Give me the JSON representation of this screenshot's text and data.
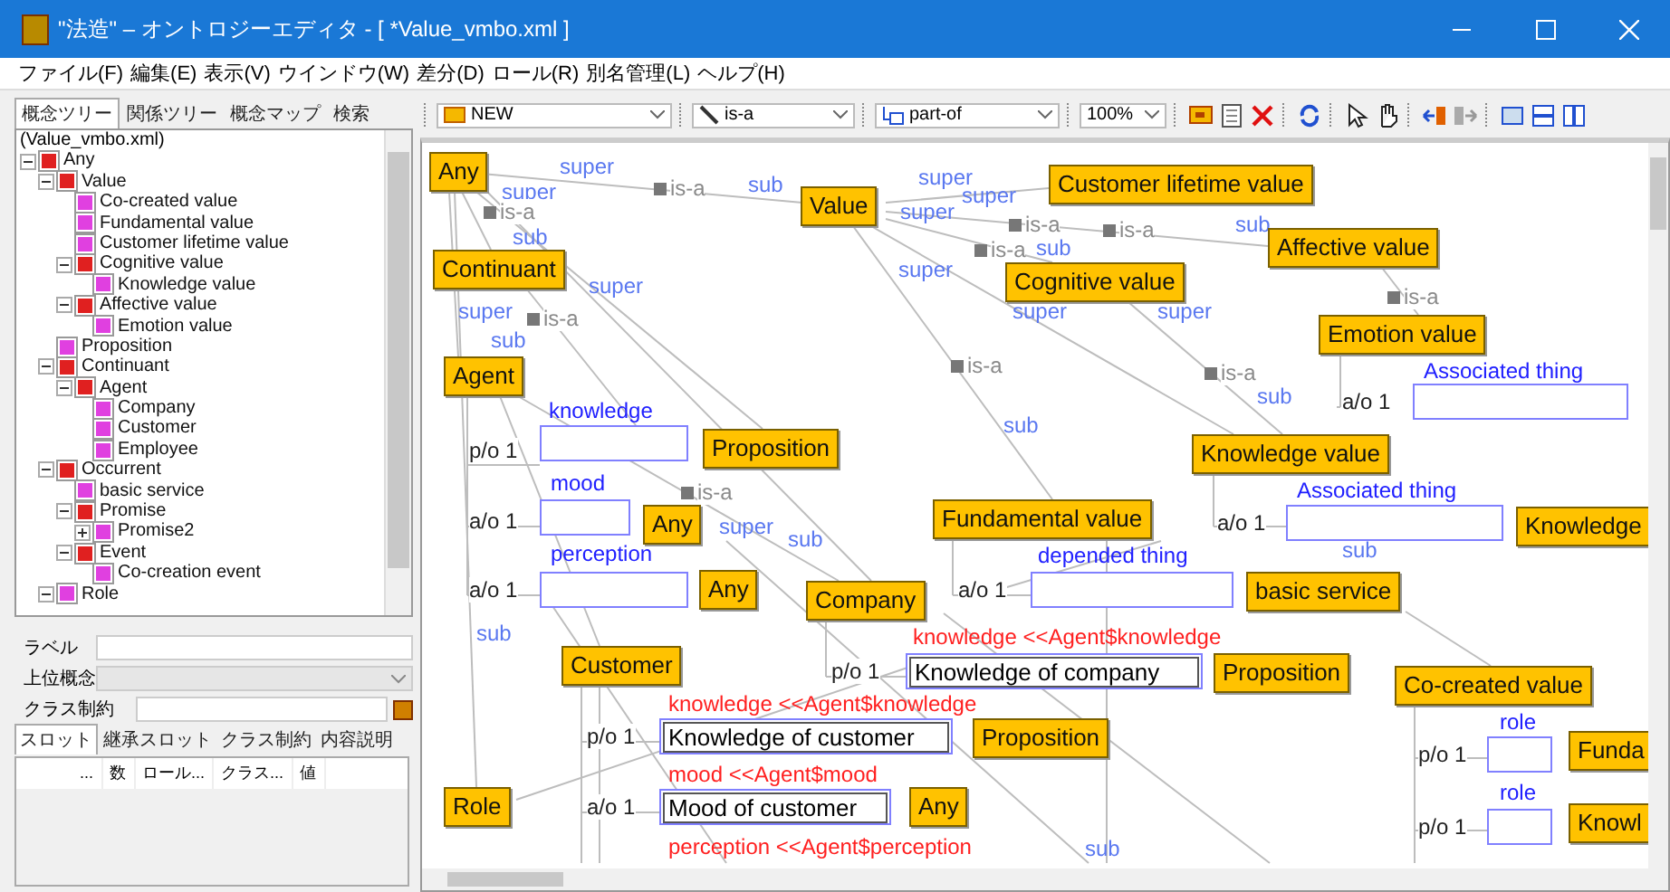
{
  "window": {
    "title": "\"法造\" – オントロジーエディタ - [ *Value_vmbo.xml ]"
  },
  "menu": [
    "ファイル(F)",
    "編集(E)",
    "表示(V)",
    "ウインドウ(W)",
    "差分(D)",
    "ロール(R)",
    "別名管理(L)",
    "ヘルプ(H)"
  ],
  "left_tabs": [
    {
      "label": "概念ツリー",
      "selected": true
    },
    {
      "label": "関係ツリー",
      "selected": false
    },
    {
      "label": "概念マップ",
      "selected": false
    },
    {
      "label": "検索",
      "selected": false
    }
  ],
  "tree": {
    "file": "(Value_vmbo.xml)",
    "items": [
      {
        "label": "Any",
        "color": "#e02020",
        "expanded": true,
        "children": [
          {
            "label": "Value",
            "color": "#e02020",
            "expanded": true,
            "children": [
              {
                "label": "Co-created value",
                "color": "#e040e0"
              },
              {
                "label": "Fundamental value",
                "color": "#e040e0"
              },
              {
                "label": "Customer lifetime value",
                "color": "#e040e0"
              },
              {
                "label": "Cognitive value",
                "color": "#e02020",
                "expanded": true,
                "children": [
                  {
                    "label": "Knowledge value",
                    "color": "#e040e0"
                  }
                ]
              },
              {
                "label": "Affective value",
                "color": "#e02020",
                "expanded": true,
                "children": [
                  {
                    "label": "Emotion value",
                    "color": "#e040e0"
                  }
                ]
              }
            ]
          },
          {
            "label": "Proposition",
            "color": "#e040e0"
          },
          {
            "label": "Continuant",
            "color": "#e02020",
            "expanded": true,
            "children": [
              {
                "label": "Agent",
                "color": "#e02020",
                "expanded": true,
                "children": [
                  {
                    "label": "Company",
                    "color": "#e040e0"
                  },
                  {
                    "label": "Customer",
                    "color": "#e040e0"
                  },
                  {
                    "label": "Employee",
                    "color": "#e040e0"
                  }
                ]
              }
            ]
          },
          {
            "label": "Occurrent",
            "color": "#e02020",
            "expanded": true,
            "children": [
              {
                "label": "basic service",
                "color": "#e040e0"
              },
              {
                "label": "Promise",
                "color": "#e02020",
                "expanded": true,
                "children": [
                  {
                    "label": "Promise2",
                    "color": "#e040e0",
                    "expanded": false
                  }
                ]
              },
              {
                "label": "Event",
                "color": "#e02020",
                "expanded": true,
                "children": [
                  {
                    "label": "Co-creation event",
                    "color": "#e040e0"
                  }
                ]
              }
            ]
          },
          {
            "label": "Role",
            "color": "#e040e0",
            "expanded": true
          }
        ]
      }
    ]
  },
  "form": {
    "label_field": "ラベル",
    "super_field": "上位概念",
    "class_constraint_field": "クラス制約"
  },
  "detail_tabs": [
    {
      "label": "スロット",
      "selected": true
    },
    {
      "label": "継承スロット",
      "selected": false
    },
    {
      "label": "クラス制約",
      "selected": false
    },
    {
      "label": "内容説明",
      "selected": false
    }
  ],
  "slot_table": {
    "columns": [
      "...",
      "数",
      "ロール...",
      "クラス...",
      "値"
    ]
  },
  "toolbar": {
    "node_type": "NEW",
    "link_type": "is-a",
    "part_type": "part-of",
    "zoom": "100%"
  },
  "canvas": {
    "nodes": [
      {
        "label": "Any"
      },
      {
        "label": "Value"
      },
      {
        "label": "Customer lifetime value"
      },
      {
        "label": "Continuant"
      },
      {
        "label": "Affective value"
      },
      {
        "label": "Cognitive value"
      },
      {
        "label": "Emotion value"
      },
      {
        "label": "Agent"
      },
      {
        "label": "Proposition"
      },
      {
        "label": "Knowledge value"
      },
      {
        "label": "Any"
      },
      {
        "label": "Fundamental value"
      },
      {
        "label": "Knowledge"
      },
      {
        "label": "Any"
      },
      {
        "label": "Company"
      },
      {
        "label": "basic service"
      },
      {
        "label": "Customer"
      },
      {
        "label": "Proposition"
      },
      {
        "label": "Co-created value"
      },
      {
        "label": "Proposition"
      },
      {
        "label": "Funda"
      },
      {
        "label": "Role"
      },
      {
        "label": "Any"
      },
      {
        "label": "Knowl"
      }
    ],
    "labels": [
      {
        "text": "super",
        "kind": "link"
      },
      {
        "text": "super",
        "kind": "link"
      },
      {
        "text": "sub",
        "kind": "link"
      },
      {
        "text": "sub",
        "kind": "link"
      },
      {
        "text": "super",
        "kind": "link"
      },
      {
        "text": "super",
        "kind": "link"
      },
      {
        "text": "sub",
        "kind": "link"
      },
      {
        "text": "super",
        "kind": "link"
      },
      {
        "text": "super",
        "kind": "link"
      },
      {
        "text": "super",
        "kind": "link"
      },
      {
        "text": "sub",
        "kind": "link"
      },
      {
        "text": "super",
        "kind": "link"
      },
      {
        "text": "super",
        "kind": "link"
      },
      {
        "text": "super",
        "kind": "link"
      },
      {
        "text": "sub",
        "kind": "link"
      },
      {
        "text": "sub",
        "kind": "link"
      },
      {
        "text": "sub",
        "kind": "link"
      },
      {
        "text": "sub",
        "kind": "link"
      },
      {
        "text": "super",
        "kind": "link"
      },
      {
        "text": "sub",
        "kind": "link"
      },
      {
        "text": "sub",
        "kind": "link"
      },
      {
        "text": "sub",
        "kind": "link"
      },
      {
        "text": "is-a",
        "kind": "isa"
      },
      {
        "text": "is-a",
        "kind": "isa"
      },
      {
        "text": "is-a",
        "kind": "isa"
      },
      {
        "text": "is-a",
        "kind": "isa"
      },
      {
        "text": "is-a",
        "kind": "isa"
      },
      {
        "text": "is-a",
        "kind": "isa"
      },
      {
        "text": "is-a",
        "kind": "isa"
      },
      {
        "text": "is-a",
        "kind": "isa"
      },
      {
        "text": "is-a",
        "kind": "isa"
      },
      {
        "text": "is-a",
        "kind": "isa"
      },
      {
        "text": "knowledge",
        "kind": "role"
      },
      {
        "text": "mood",
        "kind": "role"
      },
      {
        "text": "perception",
        "kind": "role"
      },
      {
        "text": "Associated thing",
        "kind": "role"
      },
      {
        "text": "Associated thing",
        "kind": "role"
      },
      {
        "text": "depended thing",
        "kind": "role"
      },
      {
        "text": "role",
        "kind": "role"
      },
      {
        "text": "role",
        "kind": "role"
      },
      {
        "text": "knowledge <<Agent$knowledge",
        "kind": "inherited"
      },
      {
        "text": "knowledge <<Agent$knowledge",
        "kind": "inherited"
      },
      {
        "text": "mood <<Agent$mood",
        "kind": "inherited"
      },
      {
        "text": "perception <<Agent$perception",
        "kind": "inherited"
      },
      {
        "text": "p/o 1",
        "kind": "cardinality"
      },
      {
        "text": "a/o 1",
        "kind": "cardinality"
      },
      {
        "text": "a/o 1",
        "kind": "cardinality"
      },
      {
        "text": "a/o 1",
        "kind": "cardinality"
      },
      {
        "text": "a/o 1",
        "kind": "cardinality"
      },
      {
        "text": "a/o 1",
        "kind": "cardinality"
      },
      {
        "text": "p/o 1",
        "kind": "cardinality"
      },
      {
        "text": "p/o 1",
        "kind": "cardinality"
      },
      {
        "text": "a/o 1",
        "kind": "cardinality"
      },
      {
        "text": "p/o 1",
        "kind": "cardinality"
      },
      {
        "text": "p/o 1",
        "kind": "cardinality"
      }
    ],
    "slots": [
      {
        "kind": "empty"
      },
      {
        "kind": "empty"
      },
      {
        "kind": "empty"
      },
      {
        "kind": "empty"
      },
      {
        "kind": "empty"
      },
      {
        "kind": "empty"
      },
      {
        "kind": "filled",
        "value": "Knowledge of company"
      },
      {
        "kind": "filled",
        "value": "Knowledge of customer"
      },
      {
        "kind": "filled",
        "value": "Mood of customer"
      },
      {
        "kind": "empty"
      },
      {
        "kind": "empty"
      }
    ]
  }
}
